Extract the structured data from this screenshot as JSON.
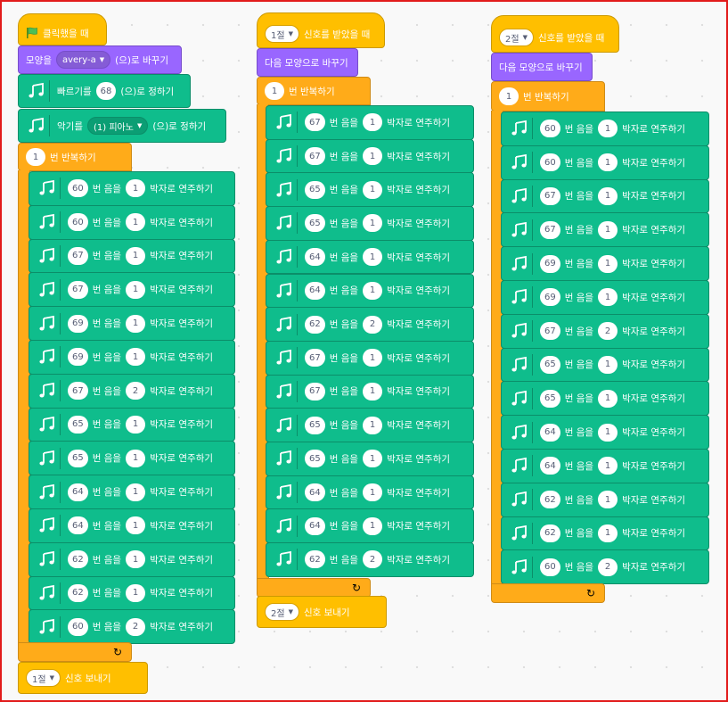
{
  "colors": {
    "events": "#ffbf00",
    "control": "#ffab19",
    "looks": "#9966ff",
    "music": "#0fbd8c",
    "frame": "#e21b1b"
  },
  "icons": {
    "flag": "green-flag-icon",
    "note": "music-note-icon",
    "dropdown": "caret-down-icon",
    "loop_end": "loop-arrow-icon"
  },
  "script1": {
    "hat_label": "클릭했을 때",
    "costume": {
      "prefix": "모양을",
      "value": "avery-a",
      "suffix": "(으)로 바꾸기"
    },
    "tempo": {
      "prefix": "빠르기를",
      "value": "68",
      "suffix": "(으)로 정하기"
    },
    "instrument": {
      "prefix": "악기를",
      "value": "(1) 피아노",
      "suffix": "(으)로 정하기"
    },
    "repeat": {
      "value": "1",
      "label": "번 반복하기"
    },
    "notes": [
      {
        "note": "60",
        "beats": "1"
      },
      {
        "note": "60",
        "beats": "1"
      },
      {
        "note": "67",
        "beats": "1"
      },
      {
        "note": "67",
        "beats": "1"
      },
      {
        "note": "69",
        "beats": "1"
      },
      {
        "note": "69",
        "beats": "1"
      },
      {
        "note": "67",
        "beats": "2"
      },
      {
        "note": "65",
        "beats": "1"
      },
      {
        "note": "65",
        "beats": "1"
      },
      {
        "note": "64",
        "beats": "1"
      },
      {
        "note": "64",
        "beats": "1"
      },
      {
        "note": "62",
        "beats": "1"
      },
      {
        "note": "62",
        "beats": "1"
      },
      {
        "note": "60",
        "beats": "2"
      }
    ],
    "broadcast": {
      "value": "1절",
      "label": "신호 보내기"
    }
  },
  "script2": {
    "hat": {
      "value": "1절",
      "label": "신호를 받았을 때"
    },
    "next_costume": "다음 모양으로 바꾸기",
    "repeat": {
      "value": "1",
      "label": "번 반복하기"
    },
    "notes": [
      {
        "note": "67",
        "beats": "1"
      },
      {
        "note": "67",
        "beats": "1"
      },
      {
        "note": "65",
        "beats": "1"
      },
      {
        "note": "65",
        "beats": "1"
      },
      {
        "note": "64",
        "beats": "1"
      },
      {
        "note": "64",
        "beats": "1"
      },
      {
        "note": "62",
        "beats": "2"
      },
      {
        "note": "67",
        "beats": "1"
      },
      {
        "note": "67",
        "beats": "1"
      },
      {
        "note": "65",
        "beats": "1"
      },
      {
        "note": "65",
        "beats": "1"
      },
      {
        "note": "64",
        "beats": "1"
      },
      {
        "note": "64",
        "beats": "1"
      },
      {
        "note": "62",
        "beats": "2"
      }
    ],
    "broadcast": {
      "value": "2절",
      "label": "신호 보내기"
    }
  },
  "script3": {
    "hat": {
      "value": "2절",
      "label": "신호를 받았을 때"
    },
    "next_costume": "다음 모양으로 바꾸기",
    "repeat": {
      "value": "1",
      "label": "번 반복하기"
    },
    "notes": [
      {
        "note": "60",
        "beats": "1"
      },
      {
        "note": "60",
        "beats": "1"
      },
      {
        "note": "67",
        "beats": "1"
      },
      {
        "note": "67",
        "beats": "1"
      },
      {
        "note": "69",
        "beats": "1"
      },
      {
        "note": "69",
        "beats": "1"
      },
      {
        "note": "67",
        "beats": "2"
      },
      {
        "note": "65",
        "beats": "1"
      },
      {
        "note": "65",
        "beats": "1"
      },
      {
        "note": "64",
        "beats": "1"
      },
      {
        "note": "64",
        "beats": "1"
      },
      {
        "note": "62",
        "beats": "1"
      },
      {
        "note": "62",
        "beats": "1"
      },
      {
        "note": "60",
        "beats": "2"
      }
    ]
  },
  "play_note_labels": {
    "mid": "번 음을",
    "end": "박자로 연주하기"
  }
}
